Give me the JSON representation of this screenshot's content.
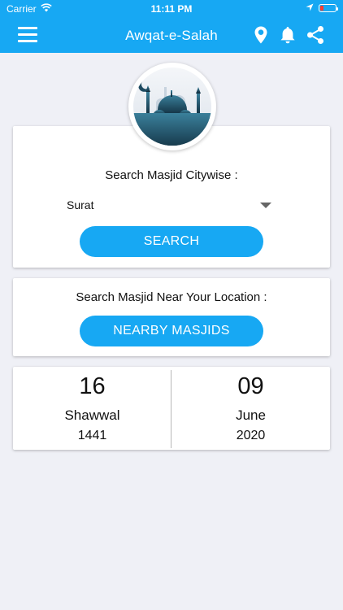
{
  "status_bar": {
    "carrier": "Carrier",
    "time": "11:11 PM"
  },
  "header": {
    "title": "Awqat-e-Salah",
    "color": "#17a8f3",
    "icons": [
      "menu-icon",
      "location-pin-icon",
      "bell-icon",
      "share-icon"
    ]
  },
  "city_search": {
    "title": "Search Masjid Citywise :",
    "selected_city": "Surat",
    "button_label": "SEARCH"
  },
  "nearby": {
    "title": "Search Masjid Near Your Location :",
    "button_label": "NEARBY MASJIDS"
  },
  "dates": {
    "hijri": {
      "day": "16",
      "month": "Shawwal",
      "year": "1441"
    },
    "gregorian": {
      "day": "09",
      "month": "June",
      "year": "2020"
    }
  }
}
